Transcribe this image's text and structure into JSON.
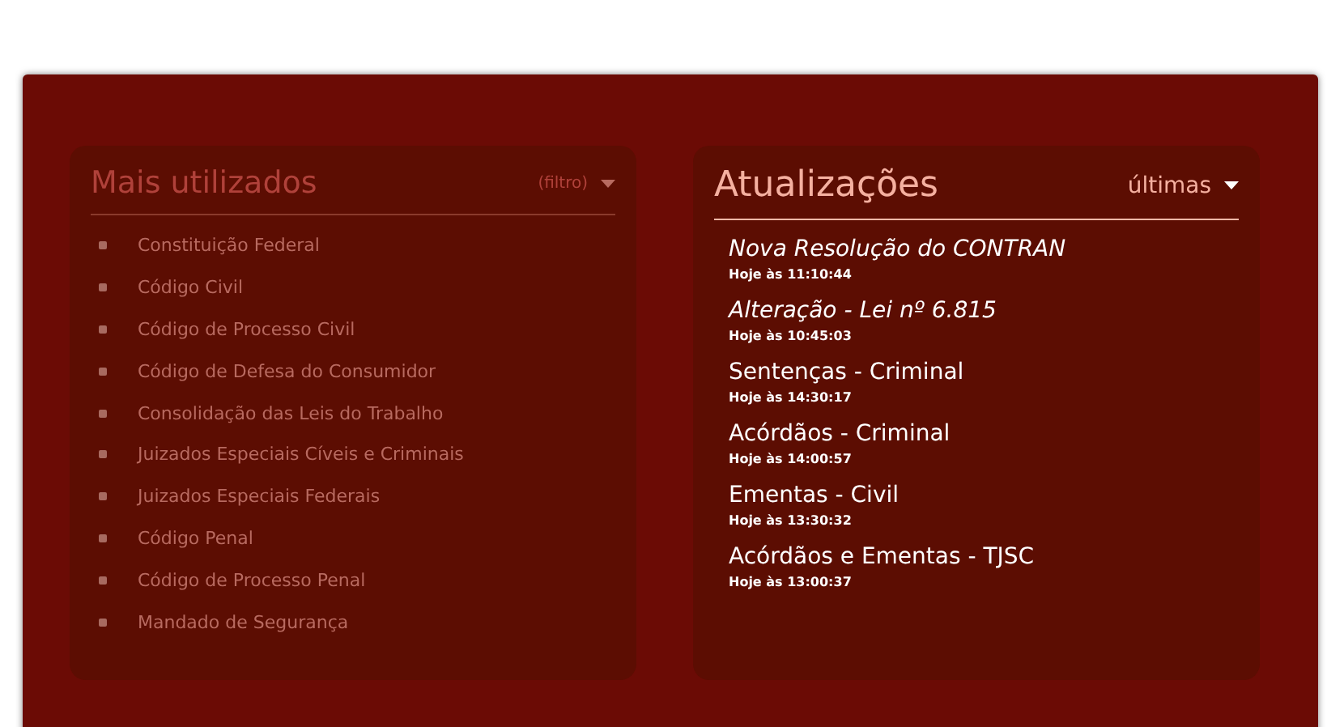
{
  "panels": [
    {
      "title": "Mais utilizados",
      "filter": "(filtro)",
      "items": [
        "Constituição Federal",
        "Código Civil",
        "Código de Processo Civil",
        "Código de Defesa do Consumidor",
        "Consolidação das Leis do Trabalho",
        "Juizados Especiais Cíveis e Criminais",
        "Juizados Especiais Federais",
        "Código Penal",
        "Código de Processo Penal",
        "Mandado de Segurança"
      ]
    },
    {
      "title": "Atualizações",
      "filter": "últimas",
      "updates": [
        {
          "title": "Nova Resolução do CONTRAN",
          "time": "Hoje às 11:10:44",
          "emphasized": true
        },
        {
          "title": "Alteração - Lei nº 6.815",
          "time": "Hoje às 10:45:03",
          "emphasized": true
        },
        {
          "title": "Sentenças - Criminal",
          "time": "Hoje às 14:30:17",
          "emphasized": false
        },
        {
          "title": "Acórdãos - Criminal",
          "time": "Hoje às 14:00:57",
          "emphasized": false
        },
        {
          "title": "Ementas - Civil",
          "time": "Hoje às 13:30:32",
          "emphasized": false
        },
        {
          "title": "Acórdãos e Ementas - TJSC",
          "time": "Hoje às 13:00:37",
          "emphasized": false
        }
      ]
    }
  ]
}
